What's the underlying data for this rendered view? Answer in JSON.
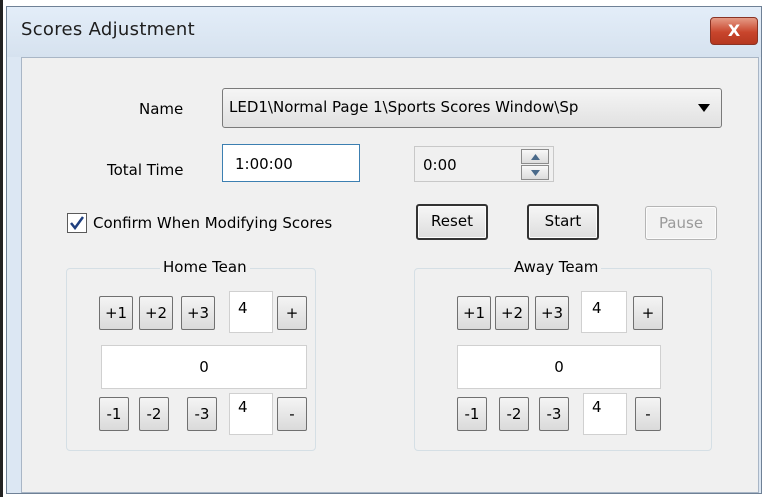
{
  "window": {
    "title": "Scores Adjustment",
    "close_label": "X"
  },
  "form": {
    "name_label": "Name",
    "name_value": "LED1\\Normal Page 1\\Sports Scores Window\\Sp",
    "total_time_label": "Total Time",
    "total_time_value": "1:00:00",
    "countdown_value": "0:00",
    "confirm_label": "Confirm When Modifying Scores",
    "confirm_checked": true,
    "reset_label": "Reset",
    "start_label": "Start",
    "pause_label": "Pause"
  },
  "home": {
    "title": "Home Tean",
    "plus1": "+1",
    "plus2": "+2",
    "plus3": "+3",
    "increment_value": "4",
    "plus": "+",
    "score": "0",
    "minus1": "-1",
    "minus2": "-2",
    "minus3": "-3",
    "decrement_value": "4",
    "minus": "-"
  },
  "away": {
    "title": "Away Team",
    "plus1": "+1",
    "plus2": "+2",
    "plus3": "+3",
    "increment_value": "4",
    "plus": "+",
    "score": "0",
    "minus1": "-1",
    "minus2": "-2",
    "minus3": "-3",
    "decrement_value": "4",
    "minus": "-"
  },
  "icons": {
    "spin_up": "spin-up-icon",
    "spin_down": "spin-down-icon",
    "dropdown": "dropdown-arrow-icon",
    "check": "checkmark-icon"
  }
}
